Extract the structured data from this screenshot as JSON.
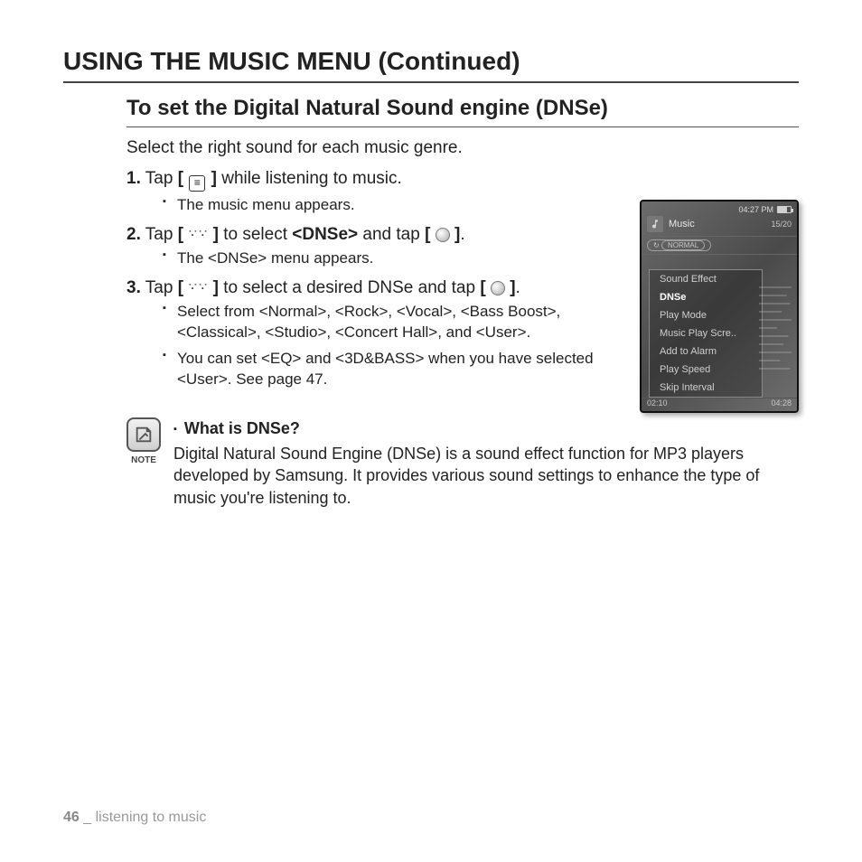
{
  "header": {
    "title": "USING THE MUSIC MENU (Continued)",
    "subtitle": "To set the Digital Natural Sound engine (DNSe)",
    "lead": "Select the right sound for each music genre."
  },
  "steps": [
    {
      "num": "1.",
      "pre": "Tap ",
      "icon1": "menu",
      "post": " while listening to music.",
      "subs": [
        "The music menu appears."
      ]
    },
    {
      "num": "2.",
      "pre": "Tap ",
      "icon1": "up-down",
      "mid": " to select ",
      "bold_mid": "<DNSe>",
      "post1": " and tap ",
      "icon2": "select",
      "post2": ".",
      "subs": [
        "The <DNSe> menu appears."
      ]
    },
    {
      "num": "3.",
      "pre": "Tap ",
      "icon1": "up-down",
      "mid": " to select a desired DNSe and tap ",
      "icon2": "select",
      "post2": ".",
      "subs": [
        "Select from <Normal>, <Rock>, <Vocal>, <Bass Boost>, <Classical>, <Studio>, <Concert Hall>, and <User>.",
        "You can set <EQ> and <3D&BASS> when you have selected <User>. See page 47."
      ]
    }
  ],
  "note": {
    "label": "NOTE",
    "heading": "What is DNSe?",
    "body": "Digital Natural Sound Engine (DNSe) is a sound effect function for MP3 players developed by Samsung. It provides various sound settings to enhance the type of music you're listening to."
  },
  "device": {
    "time": "04:27 PM",
    "title": "Music",
    "count": "15/20",
    "badge": "NORMAL",
    "menu": [
      "Sound Effect",
      "DNSe",
      "Play Mode",
      "Music Play Scre..",
      "Add to Alarm",
      "Play Speed",
      "Skip Interval"
    ],
    "selected_index": 1,
    "elapsed": "02:10",
    "total": "04:28"
  },
  "footer": {
    "page": "46",
    "sep": " _ ",
    "chapter": "listening to music"
  }
}
